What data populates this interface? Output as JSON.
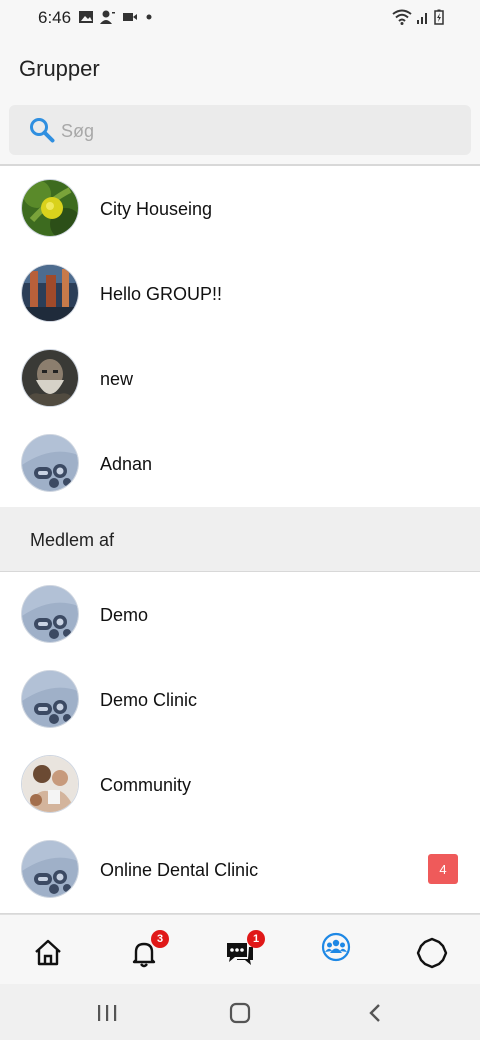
{
  "status_bar": {
    "time": "6:46"
  },
  "header": {
    "title": "Grupper"
  },
  "search": {
    "placeholder": "Søg",
    "value": ""
  },
  "owned_groups": [
    {
      "name": "City Houseing",
      "avatar": "citrus-photo"
    },
    {
      "name": "Hello GROUP!!",
      "avatar": "forest-photo"
    },
    {
      "name": "new",
      "avatar": "warrior-photo"
    },
    {
      "name": "Adnan",
      "avatar": "default-group-avatar"
    }
  ],
  "section": {
    "title": "Medlem af"
  },
  "member_groups": [
    {
      "name": "Demo",
      "avatar": "default-group-avatar",
      "badge": ""
    },
    {
      "name": "Demo Clinic",
      "avatar": "default-group-avatar",
      "badge": ""
    },
    {
      "name": "Community",
      "avatar": "people-photo",
      "badge": ""
    },
    {
      "name": "Online Dental Clinic",
      "avatar": "default-group-avatar",
      "badge": "4"
    }
  ],
  "bottom_nav": {
    "items": [
      {
        "name": "home-icon",
        "badge": ""
      },
      {
        "name": "bell-icon",
        "badge": "3"
      },
      {
        "name": "chat-icon",
        "badge": "1"
      },
      {
        "name": "groups-icon",
        "badge": "",
        "active": true
      },
      {
        "name": "settings-icon",
        "badge": ""
      }
    ],
    "active_color": "#1e88e5"
  },
  "colors": {
    "badge_red": "#ef5a5a",
    "nav_badge_red": "#e01818",
    "search_icon": "#2f8fe0"
  }
}
